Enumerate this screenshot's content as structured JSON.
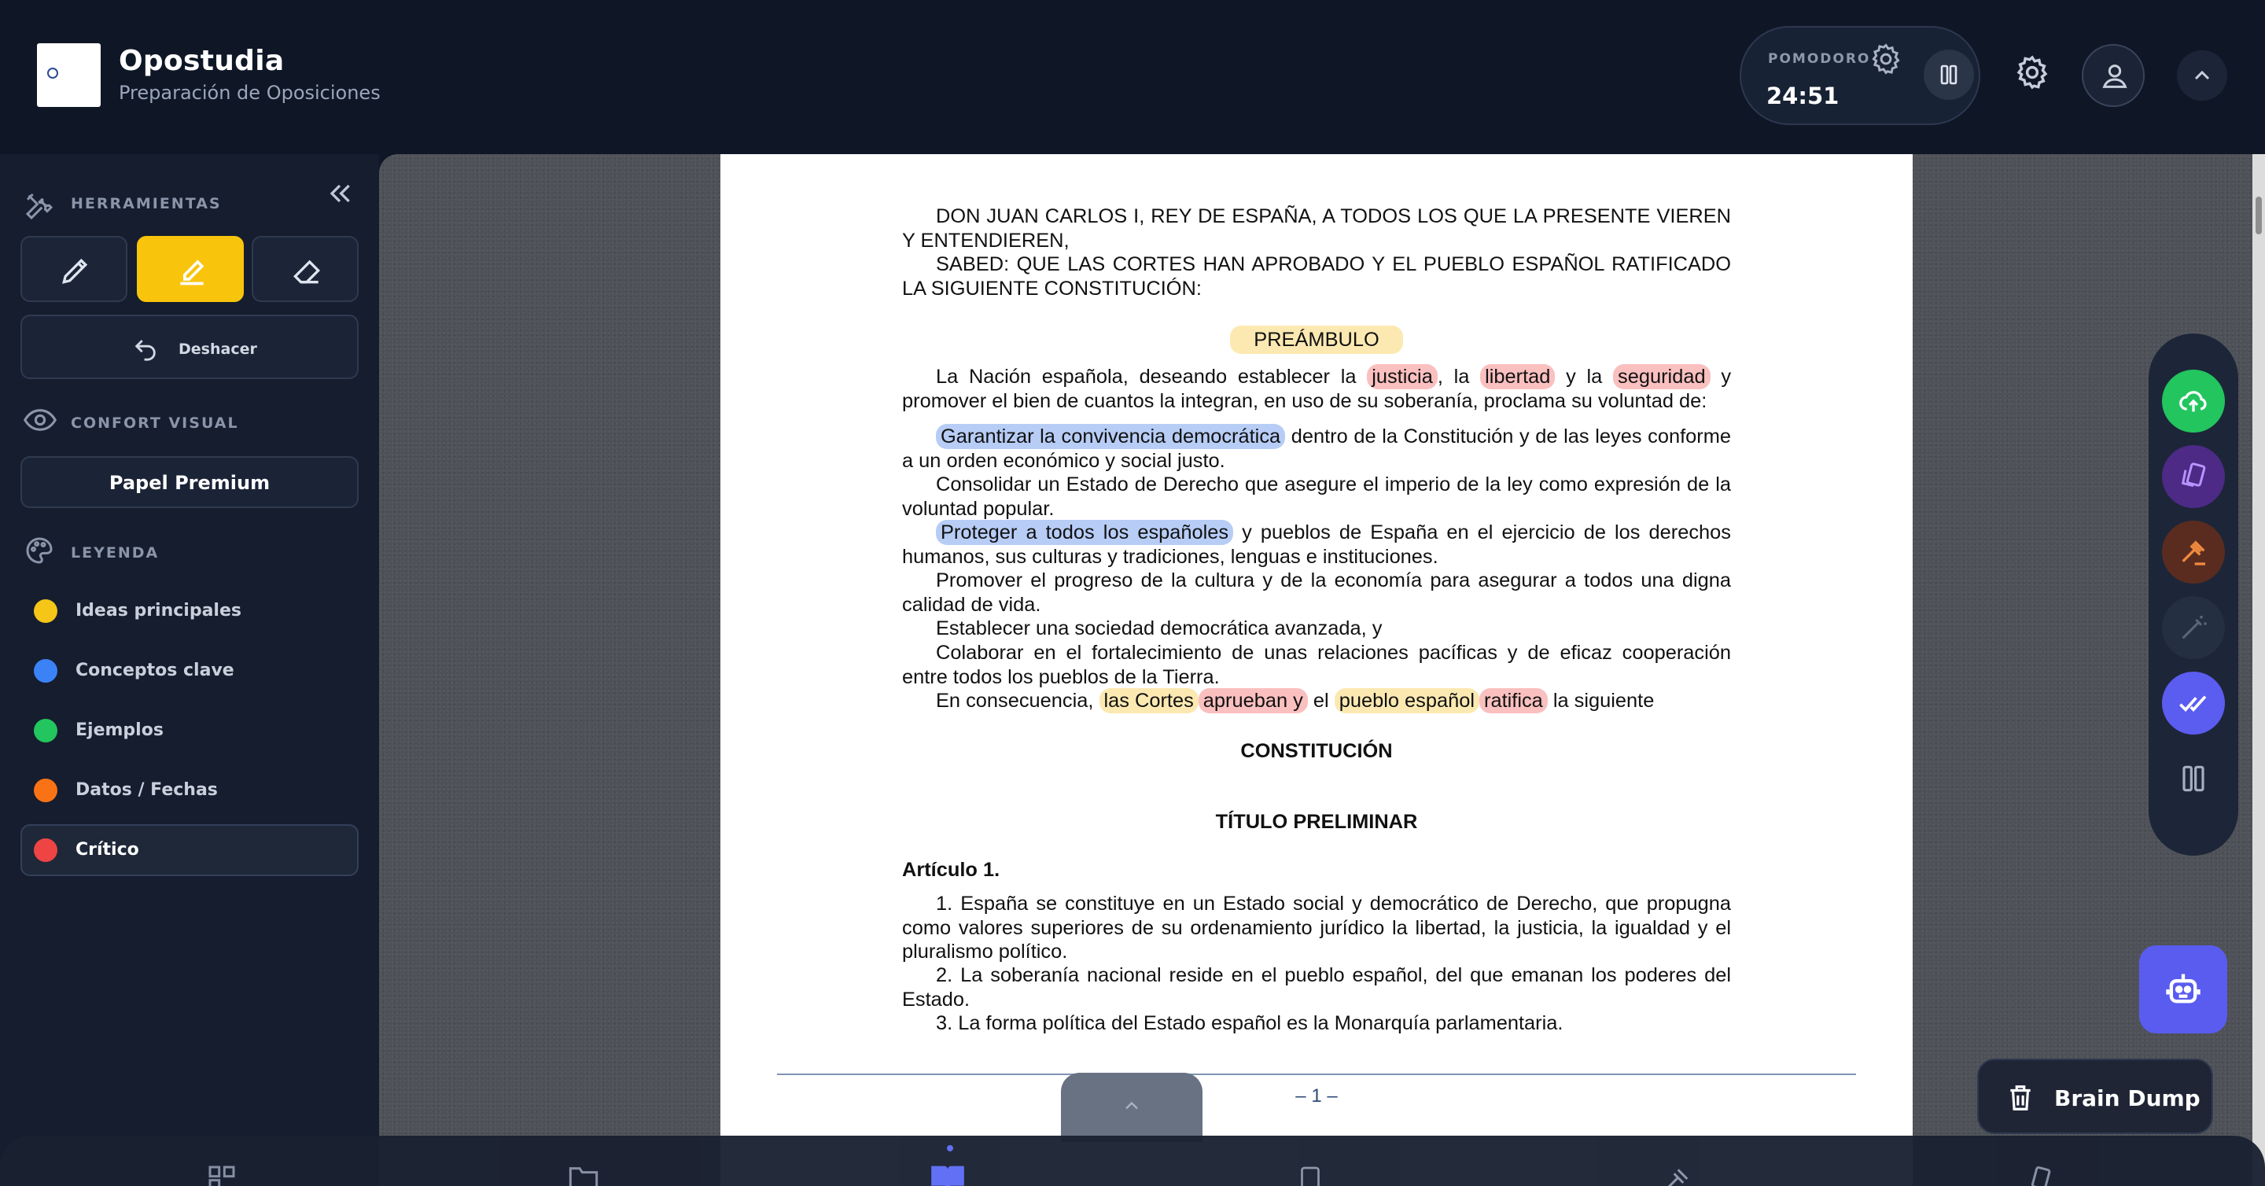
{
  "header": {
    "title": "Opostudia",
    "subtitle": "Preparación de Oposiciones",
    "pomodoro_label": "POMODORO",
    "pomodoro_time": "24:51"
  },
  "sidebar": {
    "tools_label": "HERRAMIENTAS",
    "undo_label": "Deshacer",
    "visual_label": "CONFORT VISUAL",
    "paper_label": "Papel Premium",
    "legend_label": "LEYENDA",
    "legend": [
      {
        "label": "Ideas principales",
        "color": "#f5c518"
      },
      {
        "label": "Conceptos clave",
        "color": "#3b82f6"
      },
      {
        "label": "Ejemplos",
        "color": "#22c55e"
      },
      {
        "label": "Datos / Fechas",
        "color": "#f97316"
      },
      {
        "label": "Crítico",
        "color": "#ef4444"
      }
    ]
  },
  "document": {
    "intro1": "DON JUAN CARLOS I, REY DE ESPAÑA, A TODOS LOS QUE LA PRESENTE VIEREN Y ENTENDIEREN,",
    "intro2": "SABED: QUE LAS CORTES HAN APROBADO Y EL PUEBLO ESPAÑOL RATIFICADO LA SIGUIENTE CONSTITUCIÓN:",
    "preamble_title": "PREÁMBULO",
    "p1_a": "La Nación española, deseando establecer la",
    "p1_h1": "justicia",
    "p1_b": ", la",
    "p1_h2": "libertad",
    "p1_c": "y la",
    "p1_h3": "seguridad",
    "p1_d": "y promover el bien de cuantos la integran, en uso de su soberanía, proclama su voluntad de:",
    "p2_h": "Garantizar la convivencia democrática",
    "p2_rest": "dentro de la Constitución y de las leyes conforme a un orden económico y social justo.",
    "p3": "Consolidar un Estado de Derecho que asegure el imperio de la ley como expresión de la voluntad popular.",
    "p4_h": "Proteger a todos los españoles",
    "p4_rest": "y pueblos de España en el ejercicio de los derechos humanos, sus culturas y tradiciones, lenguas e instituciones.",
    "p5": "Promover el progreso de la cultura y de la economía para asegurar a todos una digna calidad de vida.",
    "p6": "Establecer una sociedad democrática avanzada, y",
    "p7": "Colaborar en el fortalecimiento de unas relaciones pacíficas y de eficaz cooperación entre todos los pueblos de la Tierra.",
    "p8_a": "En consecuencia,",
    "p8_h1": "las Cortes",
    "p8_h2": "aprueban y",
    "p8_b": "el",
    "p8_h3": "pueblo español",
    "p8_h4": "ratifica",
    "p8_c": "la siguiente",
    "constitution_title": "CONSTITUCIÓN",
    "title_prelim": "TÍTULO PRELIMINAR",
    "article": "Artículo 1.",
    "a1": "1. España se constituye en un Estado social y democrático de Derecho, que propugna como valores superiores de su ordenamiento jurídico la libertad, la justicia, la igualdad y el pluralismo político.",
    "a2": "2. La soberanía nacional reside en el pueblo español, del que emanan los poderes del Estado.",
    "a3": "3. La forma política del Estado español es la Monarquía parlamentaria.",
    "page_number": "– 1 –"
  },
  "brain_dump": {
    "label": "Brain Dump"
  },
  "right_toolbar": {
    "buttons": [
      {
        "icon": "cloud-upload-icon",
        "color": "#22c55e"
      },
      {
        "icon": "cards-icon",
        "color": "#7c3aed"
      },
      {
        "icon": "gavel-icon",
        "color": "#c2410c"
      },
      {
        "icon": "magic-wand-icon",
        "color": "#2b3447"
      },
      {
        "icon": "double-check-icon",
        "color": "#5b5cf0"
      },
      {
        "icon": "pause-icon",
        "color": "#1d2638"
      }
    ]
  },
  "colors": {
    "accent_yellow": "#f8c40c",
    "highlight_red": "#f47171",
    "highlight_blue": "#6091eb",
    "highlight_yellow": "#f7c83c"
  }
}
